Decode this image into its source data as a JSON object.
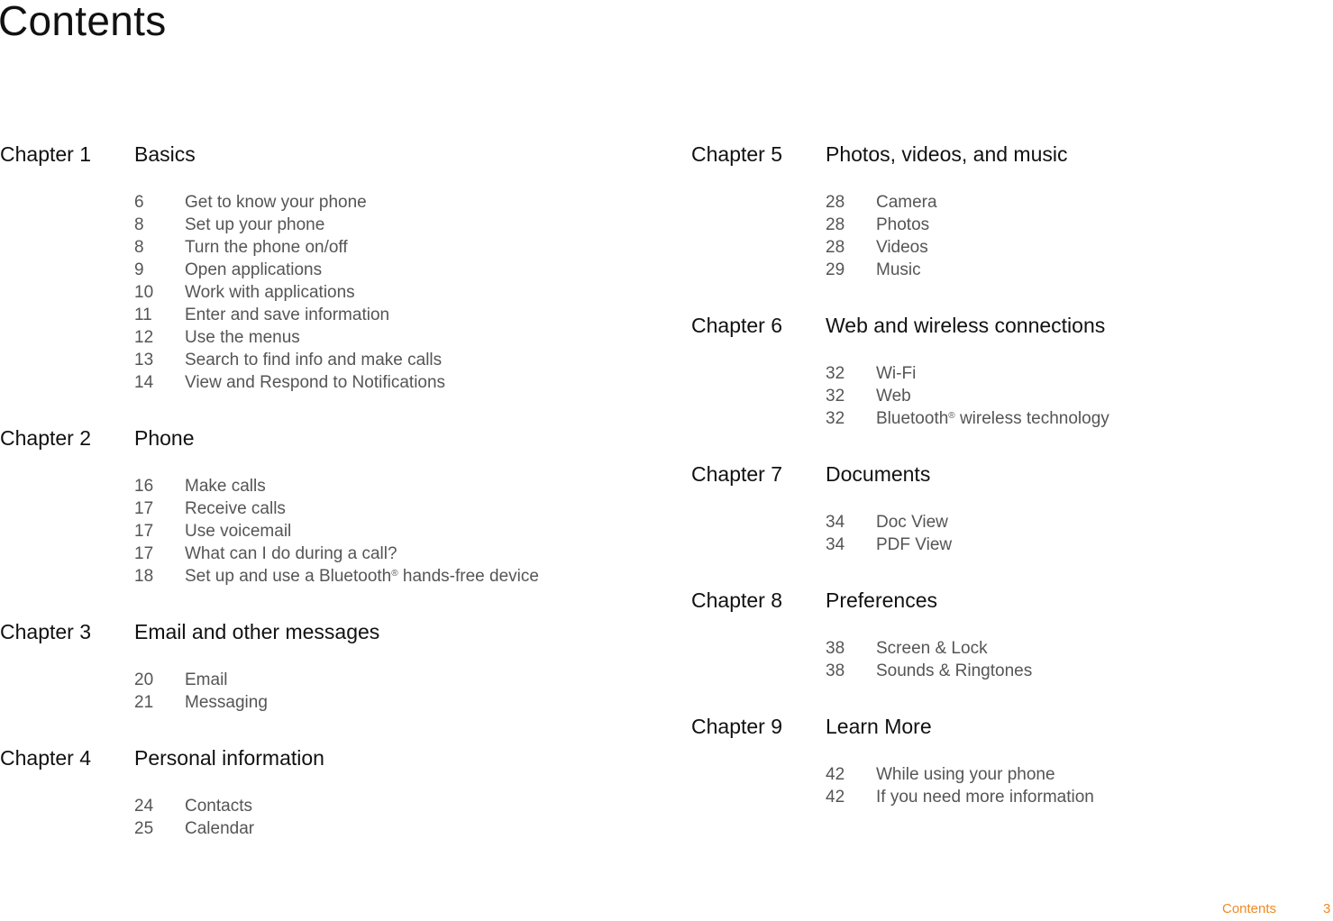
{
  "page": {
    "title": "Contents",
    "accent_color": "#f08a24"
  },
  "left_column": [
    {
      "chapter": "Chapter 1",
      "title": "Basics",
      "topics": [
        {
          "page": "6",
          "label": "Get to know your phone"
        },
        {
          "page": "8",
          "label": "Set up your phone"
        },
        {
          "page": "8",
          "label": "Turn the phone on/off"
        },
        {
          "page": "9",
          "label": "Open applications"
        },
        {
          "page": "10",
          "label": "Work with applications"
        },
        {
          "page": "11",
          "label": "Enter and save information"
        },
        {
          "page": "12",
          "label": "Use the menus"
        },
        {
          "page": "13",
          "label": "Search to find info and make calls"
        },
        {
          "page": "14",
          "label": "View and Respond to Notifications"
        }
      ]
    },
    {
      "chapter": "Chapter 2",
      "title": "Phone",
      "topics": [
        {
          "page": "16",
          "label": "Make calls"
        },
        {
          "page": "17",
          "label": "Receive calls"
        },
        {
          "page": "17",
          "label": "Use voicemail"
        },
        {
          "page": "17",
          "label": "What can I do during a call?"
        },
        {
          "page": "18",
          "label": "Set up and use a Bluetooth® hands-free device"
        }
      ]
    },
    {
      "chapter": "Chapter 3",
      "title": "Email and other messages",
      "topics": [
        {
          "page": "20",
          "label": "Email"
        },
        {
          "page": "21",
          "label": "Messaging"
        }
      ]
    },
    {
      "chapter": "Chapter 4",
      "title": "Personal information",
      "topics": [
        {
          "page": "24",
          "label": "Contacts"
        },
        {
          "page": "25",
          "label": "Calendar"
        }
      ]
    }
  ],
  "right_column": [
    {
      "chapter": "Chapter 5",
      "title": "Photos, videos, and music",
      "topics": [
        {
          "page": "28",
          "label": "Camera"
        },
        {
          "page": "28",
          "label": "Photos"
        },
        {
          "page": "28",
          "label": "Videos"
        },
        {
          "page": "29",
          "label": "Music"
        }
      ]
    },
    {
      "chapter": "Chapter 6",
      "title": "Web and wireless connections",
      "topics": [
        {
          "page": "32",
          "label": "Wi-Fi"
        },
        {
          "page": "32",
          "label": "Web"
        },
        {
          "page": "32",
          "label": "Bluetooth® wireless technology"
        }
      ]
    },
    {
      "chapter": "Chapter 7",
      "title": "Documents",
      "topics": [
        {
          "page": "34",
          "label": "Doc View"
        },
        {
          "page": "34",
          "label": "PDF View"
        }
      ]
    },
    {
      "chapter": "Chapter 8",
      "title": "Preferences",
      "topics": [
        {
          "page": "38",
          "label": "Screen & Lock"
        },
        {
          "page": "38",
          "label": "Sounds & Ringtones"
        }
      ]
    },
    {
      "chapter": "Chapter 9",
      "title": "Learn More",
      "topics": [
        {
          "page": "42",
          "label": "While using your phone"
        },
        {
          "page": "42",
          "label": "If you need more information"
        }
      ]
    }
  ],
  "footer": {
    "section_label": "Contents",
    "page_number": "3"
  }
}
